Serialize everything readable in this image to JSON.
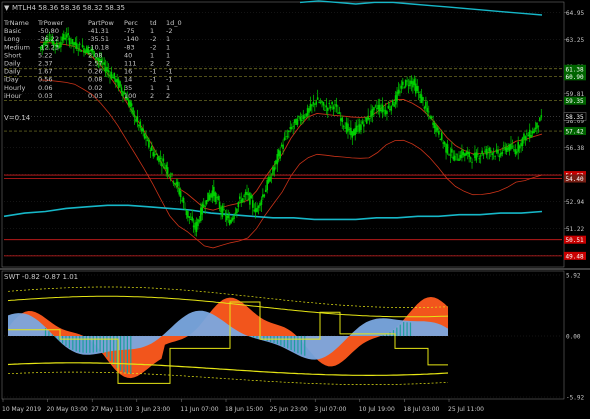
{
  "colors": {
    "background": "#000000",
    "grid": "#2a2a2a",
    "axis": "#808080",
    "text": "#c8c8c8",
    "candle": "#00d000",
    "ma_slow": "#16b7c8",
    "ma_red": "#c83218",
    "level_line": "#7f7f2a",
    "red_level": "#d21e1e",
    "badge_green": "#006400",
    "badge_red": "#c80000",
    "badge_dark_red": "#781e14",
    "swt_orange": "#ff5a1e",
    "swt_blue": "#7aa8e0",
    "swt_teal": "#1e9e9e",
    "swt_yellow": "#e6e614"
  },
  "main_title": "MTLH4 58.36 58.36 58.32 58.35",
  "table": {
    "headers": [
      "TrName",
      "TrPower",
      "PartPow",
      "Perc",
      "td",
      "1d_0"
    ],
    "rows": [
      [
        "Basic",
        "-50.80",
        "-41.31",
        "-75",
        "1",
        "-2"
      ],
      [
        "Long",
        "-36.22",
        "-35.51",
        "-140",
        "-2",
        "1"
      ],
      [
        "Medium",
        "-12.23",
        "-10.18",
        "-83",
        "-2",
        "1"
      ],
      [
        "Short",
        "5.22",
        "2.08",
        "40",
        "1",
        "1"
      ],
      [
        "Daily",
        "2.37",
        "2.57",
        "111",
        "2",
        "2"
      ],
      [
        "Daily",
        "1.67",
        "0.26",
        "16",
        "-1",
        "-1"
      ],
      [
        "iDay",
        "0.56",
        "0.08",
        "14",
        "-1",
        "-1"
      ],
      [
        "Hourly",
        "0.06",
        "0.02",
        "35",
        "1",
        "1"
      ],
      [
        "iHour",
        "0.03",
        "0.03",
        "100",
        "2",
        "2"
      ]
    ],
    "vol_text": "V=0.14"
  },
  "price_axis": {
    "ticks": [
      "64.95",
      "63.25",
      "61.53",
      "59.81",
      "58.09",
      "56.38",
      "54.66",
      "52.94",
      "51.22",
      "49.51"
    ]
  },
  "price_badges": [
    {
      "text": "61.38",
      "price": 61.38,
      "color": "#006400"
    },
    {
      "text": "60.90",
      "price": 60.9,
      "color": "#006400"
    },
    {
      "text": "59.35",
      "price": 59.35,
      "color": "#006400"
    },
    {
      "text": "58.35",
      "price": 58.35,
      "color": "#000000"
    },
    {
      "text": "57.42",
      "price": 57.42,
      "color": "#006400"
    },
    {
      "text": "54.62",
      "price": 54.62,
      "color": "#c80000"
    },
    {
      "text": "54.40",
      "price": 54.4,
      "color": "#781e14"
    },
    {
      "text": "50.51",
      "price": 50.51,
      "color": "#c80000"
    },
    {
      "text": "49.48",
      "price": 49.48,
      "color": "#c80000"
    }
  ],
  "indicator": {
    "title": "SWT -0.82 -0.87 1.01",
    "ticks": [
      "5.92",
      "0.00",
      "-5.92"
    ],
    "range": [
      -5.92,
      5.92
    ]
  },
  "time_axis": {
    "labels": [
      "10 May 2019",
      "20 May 03:00",
      "27 May 11:00",
      "3 Jun 23:00",
      "11 Jun 07:00",
      "18 Jun 15:00",
      "25 Jun 23:00",
      "3 Jul 07:00",
      "10 Jul 19:00",
      "18 Jul 03:00",
      "25 Jul 11:00"
    ]
  },
  "chart_data": {
    "type": "candlestick",
    "title": "MTLH4 58.36 58.36 58.32 58.35",
    "ylim": [
      48.9,
      65.5
    ],
    "x_labels": [
      "10 May 2019",
      "20 May 03:00",
      "27 May 11:00",
      "3 Jun 23:00",
      "11 Jun 07:00",
      "18 Jun 15:00",
      "25 Jun 23:00",
      "3 Jul 07:00",
      "10 Jul 19:00",
      "18 Jul 03:00",
      "25 Jul 11:00"
    ],
    "close_path": [
      62.6,
      63.4,
      62.8,
      63.5,
      62.9,
      62.7,
      62.5,
      61.8,
      61.2,
      60.5,
      59.6,
      58.3,
      57.2,
      56.1,
      55.6,
      54.8,
      53.8,
      52.2,
      51.2,
      52.8,
      53.6,
      52.4,
      51.6,
      52.9,
      53.4,
      52.3,
      53.6,
      54.9,
      56.5,
      57.6,
      58.2,
      58.6,
      59.4,
      58.9,
      59.1,
      58.0,
      57.2,
      57.7,
      58.3,
      59.0,
      58.7,
      59.3,
      60.4,
      60.6,
      59.6,
      58.4,
      57.4,
      56.3,
      55.7,
      56.0,
      55.7,
      56.0,
      56.2,
      55.9,
      56.4,
      56.2,
      57.0,
      57.4,
      58.3
    ]
  }
}
